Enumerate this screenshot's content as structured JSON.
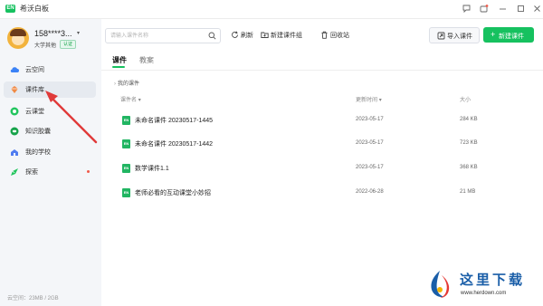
{
  "window": {
    "app_title": "希沃白板",
    "logo_text": "EN"
  },
  "user": {
    "name": "158****3...",
    "org": "大学其他",
    "badge": "认证"
  },
  "sidebar": {
    "items": [
      {
        "label": "云空间",
        "icon": "cloud-icon",
        "active": false
      },
      {
        "label": "课件库",
        "icon": "courseware-icon",
        "active": true
      },
      {
        "label": "云课堂",
        "icon": "cloud-class-icon",
        "active": false
      },
      {
        "label": "知识胶囊",
        "icon": "capsule-icon",
        "active": false
      },
      {
        "label": "我的学校",
        "icon": "school-icon",
        "active": false
      },
      {
        "label": "探索",
        "icon": "explore-icon",
        "active": false
      }
    ],
    "storage": "云空间：23MB / 2GB"
  },
  "toolbar": {
    "search_placeholder": "请输入课件名称",
    "refresh": "刷新",
    "new_group": "新建课件组",
    "recycle": "回收站",
    "import": "导入课件",
    "new_courseware": "新建课件"
  },
  "tabs": [
    {
      "label": "课件",
      "active": true
    },
    {
      "label": "教案",
      "active": false
    }
  ],
  "breadcrumb": "我的课件",
  "table": {
    "headers": {
      "name": "课件名",
      "updated": "更新时间",
      "size": "大小"
    },
    "rows": [
      {
        "name": "未命名课件 20230517-1445",
        "updated": "2023-05-17",
        "size": "284 KB"
      },
      {
        "name": "未命名课件 20230517-1442",
        "updated": "2023-05-17",
        "size": "723 KB"
      },
      {
        "name": "数学课件1.1",
        "updated": "2023-05-17",
        "size": "368 KB"
      },
      {
        "name": "老师必看的互动课堂小妙招",
        "updated": "2022-06-28",
        "size": "21 MB"
      }
    ]
  },
  "watermark": {
    "cn": "这里下载",
    "url": "www.herdown.com"
  },
  "colors": {
    "accent": "#16c15f",
    "annotation_arrow": "#e03a3a"
  }
}
